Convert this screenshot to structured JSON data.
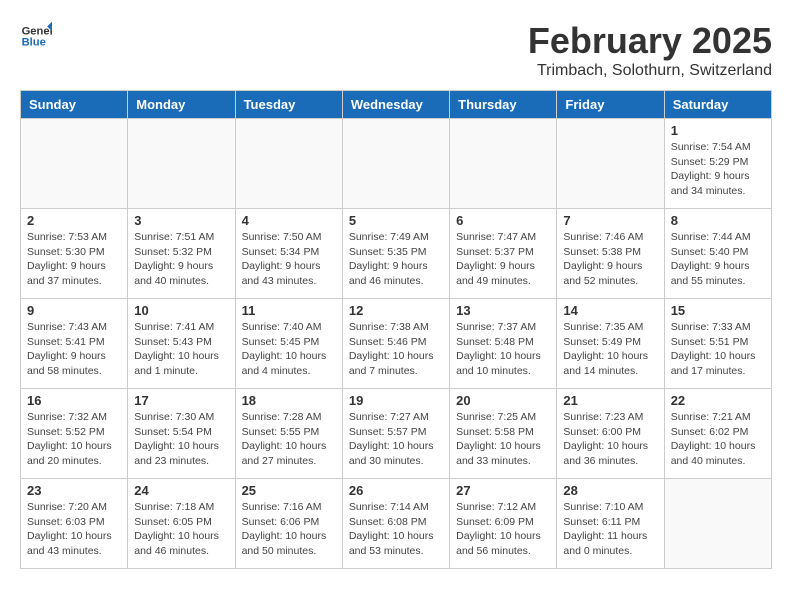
{
  "header": {
    "logo_general": "General",
    "logo_blue": "Blue",
    "month_year": "February 2025",
    "location": "Trimbach, Solothurn, Switzerland"
  },
  "weekdays": [
    "Sunday",
    "Monday",
    "Tuesday",
    "Wednesday",
    "Thursday",
    "Friday",
    "Saturday"
  ],
  "weeks": [
    [
      {
        "day": "",
        "info": ""
      },
      {
        "day": "",
        "info": ""
      },
      {
        "day": "",
        "info": ""
      },
      {
        "day": "",
        "info": ""
      },
      {
        "day": "",
        "info": ""
      },
      {
        "day": "",
        "info": ""
      },
      {
        "day": "1",
        "info": "Sunrise: 7:54 AM\nSunset: 5:29 PM\nDaylight: 9 hours\nand 34 minutes."
      }
    ],
    [
      {
        "day": "2",
        "info": "Sunrise: 7:53 AM\nSunset: 5:30 PM\nDaylight: 9 hours\nand 37 minutes."
      },
      {
        "day": "3",
        "info": "Sunrise: 7:51 AM\nSunset: 5:32 PM\nDaylight: 9 hours\nand 40 minutes."
      },
      {
        "day": "4",
        "info": "Sunrise: 7:50 AM\nSunset: 5:34 PM\nDaylight: 9 hours\nand 43 minutes."
      },
      {
        "day": "5",
        "info": "Sunrise: 7:49 AM\nSunset: 5:35 PM\nDaylight: 9 hours\nand 46 minutes."
      },
      {
        "day": "6",
        "info": "Sunrise: 7:47 AM\nSunset: 5:37 PM\nDaylight: 9 hours\nand 49 minutes."
      },
      {
        "day": "7",
        "info": "Sunrise: 7:46 AM\nSunset: 5:38 PM\nDaylight: 9 hours\nand 52 minutes."
      },
      {
        "day": "8",
        "info": "Sunrise: 7:44 AM\nSunset: 5:40 PM\nDaylight: 9 hours\nand 55 minutes."
      }
    ],
    [
      {
        "day": "9",
        "info": "Sunrise: 7:43 AM\nSunset: 5:41 PM\nDaylight: 9 hours\nand 58 minutes."
      },
      {
        "day": "10",
        "info": "Sunrise: 7:41 AM\nSunset: 5:43 PM\nDaylight: 10 hours\nand 1 minute."
      },
      {
        "day": "11",
        "info": "Sunrise: 7:40 AM\nSunset: 5:45 PM\nDaylight: 10 hours\nand 4 minutes."
      },
      {
        "day": "12",
        "info": "Sunrise: 7:38 AM\nSunset: 5:46 PM\nDaylight: 10 hours\nand 7 minutes."
      },
      {
        "day": "13",
        "info": "Sunrise: 7:37 AM\nSunset: 5:48 PM\nDaylight: 10 hours\nand 10 minutes."
      },
      {
        "day": "14",
        "info": "Sunrise: 7:35 AM\nSunset: 5:49 PM\nDaylight: 10 hours\nand 14 minutes."
      },
      {
        "day": "15",
        "info": "Sunrise: 7:33 AM\nSunset: 5:51 PM\nDaylight: 10 hours\nand 17 minutes."
      }
    ],
    [
      {
        "day": "16",
        "info": "Sunrise: 7:32 AM\nSunset: 5:52 PM\nDaylight: 10 hours\nand 20 minutes."
      },
      {
        "day": "17",
        "info": "Sunrise: 7:30 AM\nSunset: 5:54 PM\nDaylight: 10 hours\nand 23 minutes."
      },
      {
        "day": "18",
        "info": "Sunrise: 7:28 AM\nSunset: 5:55 PM\nDaylight: 10 hours\nand 27 minutes."
      },
      {
        "day": "19",
        "info": "Sunrise: 7:27 AM\nSunset: 5:57 PM\nDaylight: 10 hours\nand 30 minutes."
      },
      {
        "day": "20",
        "info": "Sunrise: 7:25 AM\nSunset: 5:58 PM\nDaylight: 10 hours\nand 33 minutes."
      },
      {
        "day": "21",
        "info": "Sunrise: 7:23 AM\nSunset: 6:00 PM\nDaylight: 10 hours\nand 36 minutes."
      },
      {
        "day": "22",
        "info": "Sunrise: 7:21 AM\nSunset: 6:02 PM\nDaylight: 10 hours\nand 40 minutes."
      }
    ],
    [
      {
        "day": "23",
        "info": "Sunrise: 7:20 AM\nSunset: 6:03 PM\nDaylight: 10 hours\nand 43 minutes."
      },
      {
        "day": "24",
        "info": "Sunrise: 7:18 AM\nSunset: 6:05 PM\nDaylight: 10 hours\nand 46 minutes."
      },
      {
        "day": "25",
        "info": "Sunrise: 7:16 AM\nSunset: 6:06 PM\nDaylight: 10 hours\nand 50 minutes."
      },
      {
        "day": "26",
        "info": "Sunrise: 7:14 AM\nSunset: 6:08 PM\nDaylight: 10 hours\nand 53 minutes."
      },
      {
        "day": "27",
        "info": "Sunrise: 7:12 AM\nSunset: 6:09 PM\nDaylight: 10 hours\nand 56 minutes."
      },
      {
        "day": "28",
        "info": "Sunrise: 7:10 AM\nSunset: 6:11 PM\nDaylight: 11 hours\nand 0 minutes."
      },
      {
        "day": "",
        "info": ""
      }
    ]
  ]
}
